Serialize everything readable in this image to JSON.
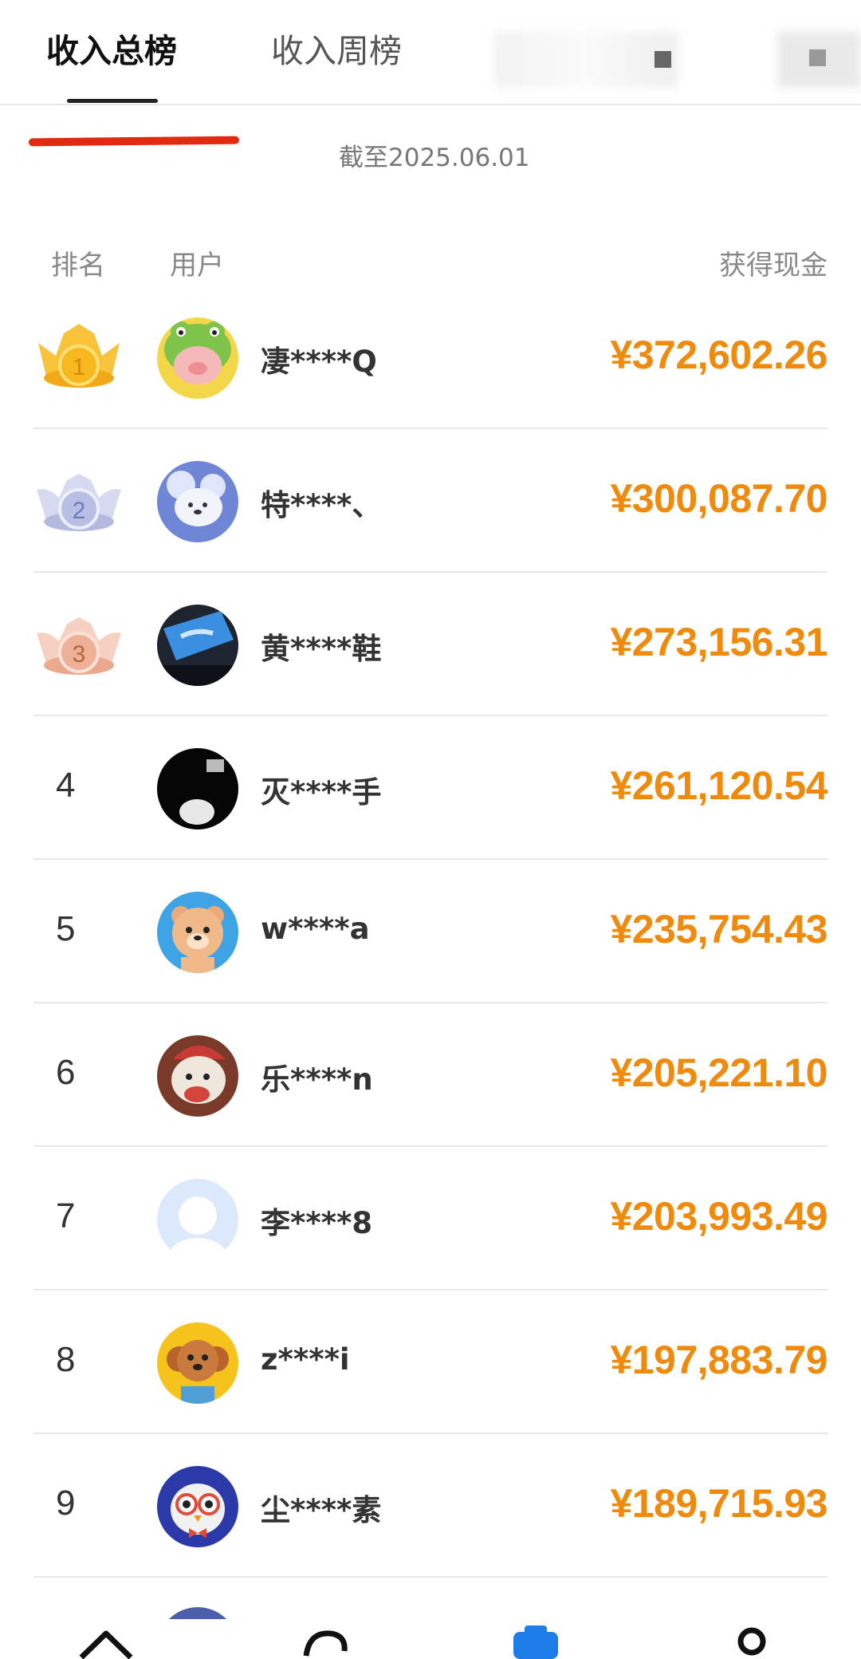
{
  "tabs": [
    {
      "label": "收入总榜",
      "active": true
    },
    {
      "label": "收入周榜",
      "active": false
    }
  ],
  "as_of": "截至2025.06.01",
  "columns": {
    "rank": "排名",
    "user": "用户",
    "cash": "获得现金"
  },
  "rows": [
    {
      "rank": "1",
      "medal": "gold",
      "avatar": "frog-pig-avatar",
      "name": "凄****Q",
      "amount": "¥372,602.26"
    },
    {
      "rank": "2",
      "medal": "silver",
      "avatar": "bear-cloud-avatar",
      "name": "特****、",
      "amount": "¥300,087.70"
    },
    {
      "rank": "3",
      "medal": "bronze",
      "avatar": "car-sky-avatar",
      "name": "黄****鞋",
      "amount": "¥273,156.31"
    },
    {
      "rank": "4",
      "medal": "",
      "avatar": "dark-avatar",
      "name": "灭****手",
      "amount": "¥261,120.54"
    },
    {
      "rank": "5",
      "medal": "",
      "avatar": "bear-cartoon-avatar",
      "name": "w****a",
      "amount": "¥235,754.43"
    },
    {
      "rank": "6",
      "medal": "",
      "avatar": "dog-santa-avatar",
      "name": "乐****n",
      "amount": "¥205,221.10"
    },
    {
      "rank": "7",
      "medal": "",
      "avatar": "default-avatar",
      "name": "李****8",
      "amount": "¥203,993.49"
    },
    {
      "rank": "8",
      "medal": "",
      "avatar": "poodle-avatar",
      "name": "z****i",
      "amount": "¥197,883.79"
    },
    {
      "rank": "9",
      "medal": "",
      "avatar": "owl-avatar",
      "name": "尘****素",
      "amount": "¥189,715.93"
    }
  ],
  "colors": {
    "amount": "#f08a0c",
    "gold": "#f5b41c",
    "silver": "#a9afd6",
    "bronze": "#e9a88c",
    "highlight_mark": "#e02a12",
    "nav_active": "#1e7de8"
  },
  "bottom_nav": [
    "home-icon",
    "planet-icon",
    "task-icon",
    "profile-icon"
  ]
}
